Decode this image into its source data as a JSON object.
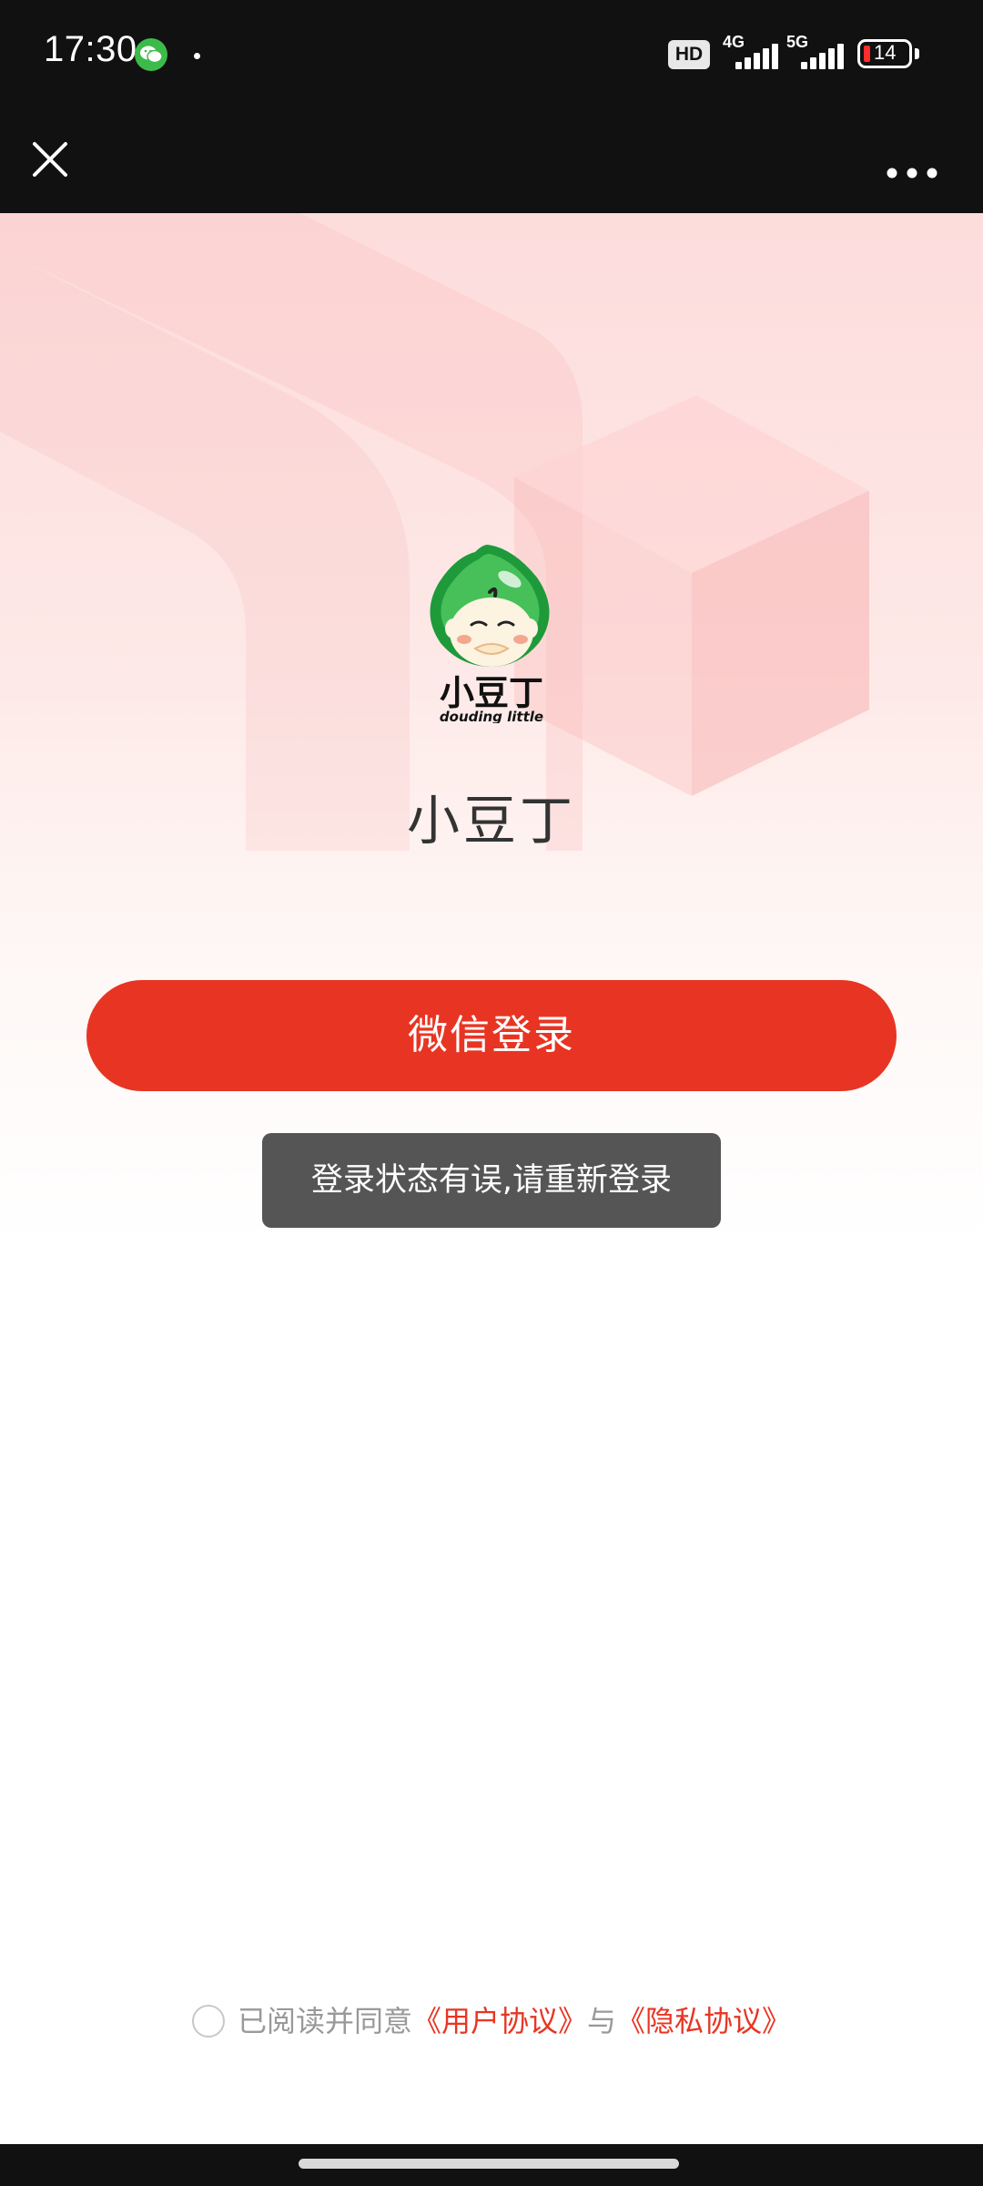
{
  "status_bar": {
    "time": "17:30",
    "hd_label": "HD",
    "net1": "4G",
    "net2": "5G",
    "battery": "14",
    "icons": [
      "wechat-notification-icon",
      "signal-icon",
      "battery-icon"
    ]
  },
  "nav": {
    "close_icon": "close-icon",
    "more_icon": "more-icon"
  },
  "app": {
    "name": "小豆丁",
    "logo_text": "小豆丁",
    "logo_subtext": "douding little"
  },
  "login": {
    "button_label": "微信登录"
  },
  "toast": {
    "message": "登录状态有误,请重新登录"
  },
  "agreement": {
    "checked": false,
    "prefix": "已阅读并同意",
    "user_agreement": "《用户协议》",
    "conjunction": "与",
    "privacy_agreement": "《隐私协议》"
  },
  "colors": {
    "accent": "#e83523",
    "toast_bg": "#555555",
    "bar_bg": "#111111"
  }
}
